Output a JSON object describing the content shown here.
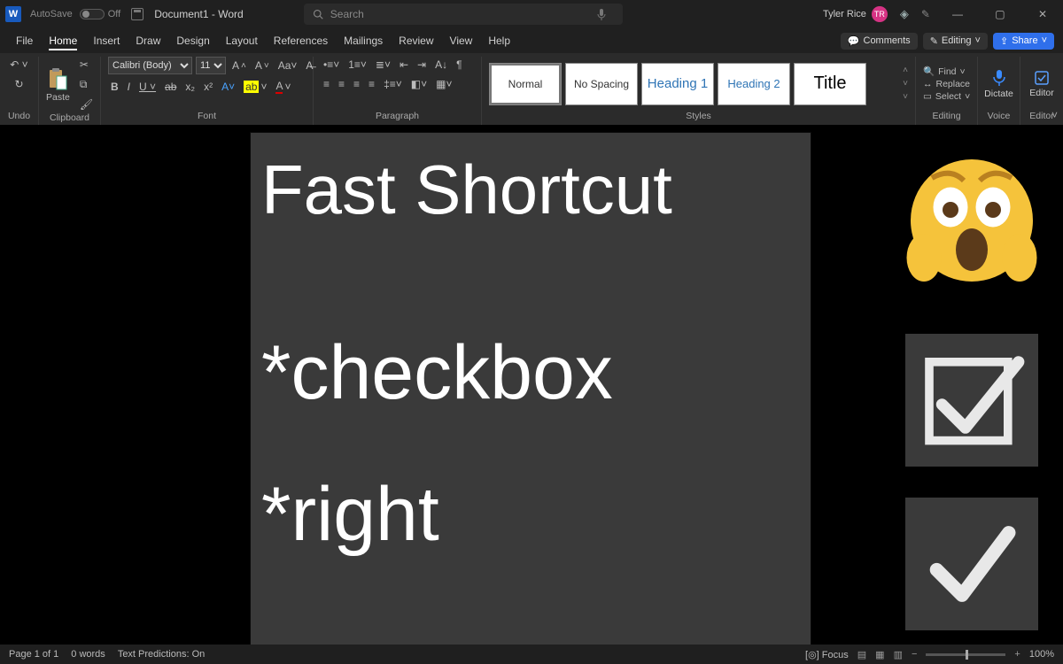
{
  "titlebar": {
    "autosave_label": "AutoSave",
    "autosave_state": "Off",
    "doc_title": "Document1 - Word",
    "search_placeholder": "Search",
    "user_name": "Tyler Rice",
    "user_initials": "TR"
  },
  "menubar": {
    "items": [
      "File",
      "Home",
      "Insert",
      "Draw",
      "Design",
      "Layout",
      "References",
      "Mailings",
      "Review",
      "View",
      "Help"
    ],
    "active": "Home",
    "comments_label": "Comments",
    "editing_label": "Editing",
    "share_label": "Share"
  },
  "ribbon": {
    "undo_label": "Undo",
    "clipboard_label": "Clipboard",
    "paste_label": "Paste",
    "font_label": "Font",
    "font_name": "Calibri (Body)",
    "font_size": "11",
    "paragraph_label": "Paragraph",
    "styles_label": "Styles",
    "styles": [
      "Normal",
      "No Spacing",
      "Heading 1",
      "Heading 2",
      "Title"
    ],
    "editing_label": "Editing",
    "find_label": "Find",
    "replace_label": "Replace",
    "select_label": "Select",
    "voice_label": "Voice",
    "dictate_label": "Dictate",
    "editor_group": "Editor",
    "editor_btn": "Editor"
  },
  "document": {
    "line1": "Fast Shortcut",
    "line2": "*checkbox",
    "line3": "*right"
  },
  "status": {
    "page": "Page 1 of 1",
    "words": "0 words",
    "predictions": "Text Predictions: On",
    "focus": "Focus",
    "zoom": "100%"
  }
}
